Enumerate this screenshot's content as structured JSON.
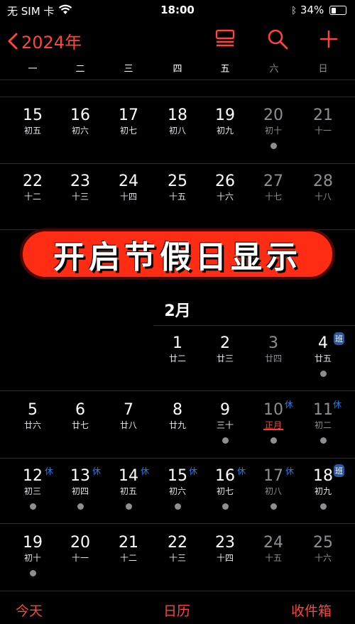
{
  "status": {
    "carrier": "无 SIM 卡",
    "time": "18:00",
    "battery": "34%"
  },
  "nav": {
    "year": "2024年"
  },
  "weekdays": [
    "一",
    "二",
    "三",
    "四",
    "五",
    "六",
    "日"
  ],
  "banner": "开启节假日显示",
  "month_feb": "2月",
  "jan_week3": [
    {
      "n": "15",
      "l": "初五"
    },
    {
      "n": "16",
      "l": "初六"
    },
    {
      "n": "17",
      "l": "初七"
    },
    {
      "n": "18",
      "l": "初八"
    },
    {
      "n": "19",
      "l": "初九"
    },
    {
      "n": "20",
      "l": "初十"
    },
    {
      "n": "21",
      "l": "十一"
    }
  ],
  "jan_week4": [
    {
      "n": "22",
      "l": "十二"
    },
    {
      "n": "23",
      "l": "十三"
    },
    {
      "n": "24",
      "l": "十四"
    },
    {
      "n": "25",
      "l": "十五"
    },
    {
      "n": "26",
      "l": "十六"
    },
    {
      "n": "27",
      "l": "十七"
    },
    {
      "n": "28",
      "l": "十八"
    }
  ],
  "feb_week1": [
    {
      "n": "1",
      "l": "廿二"
    },
    {
      "n": "2",
      "l": "廿三"
    },
    {
      "n": "3",
      "l": "廿四"
    },
    {
      "n": "4",
      "l": "廿五"
    }
  ],
  "feb_week2": [
    {
      "n": "5",
      "l": "廿六"
    },
    {
      "n": "6",
      "l": "廿七"
    },
    {
      "n": "7",
      "l": "廿八"
    },
    {
      "n": "8",
      "l": "廿九"
    },
    {
      "n": "9",
      "l": "三十"
    },
    {
      "n": "10",
      "l": "正月"
    },
    {
      "n": "11",
      "l": "初二"
    }
  ],
  "feb_week3": [
    {
      "n": "12",
      "l": "初三"
    },
    {
      "n": "13",
      "l": "初四"
    },
    {
      "n": "14",
      "l": "初五"
    },
    {
      "n": "15",
      "l": "初六"
    },
    {
      "n": "16",
      "l": "初七"
    },
    {
      "n": "17",
      "l": "初八"
    },
    {
      "n": "18",
      "l": "初九"
    }
  ],
  "feb_week4": [
    {
      "n": "19",
      "l": "初十"
    },
    {
      "n": "20",
      "l": "十一"
    },
    {
      "n": "21",
      "l": "十二"
    },
    {
      "n": "22",
      "l": "十三"
    },
    {
      "n": "23",
      "l": "十四"
    },
    {
      "n": "24",
      "l": "十五"
    },
    {
      "n": "25",
      "l": "十六"
    }
  ],
  "tags": {
    "xiu": "休",
    "ban": "班"
  },
  "tabs": {
    "today": "今天",
    "calendars": "日历",
    "inbox": "收件箱"
  },
  "colors": {
    "accent": "#ff453a",
    "holiday": "#0a84ff",
    "banner": "#ff2c14"
  }
}
